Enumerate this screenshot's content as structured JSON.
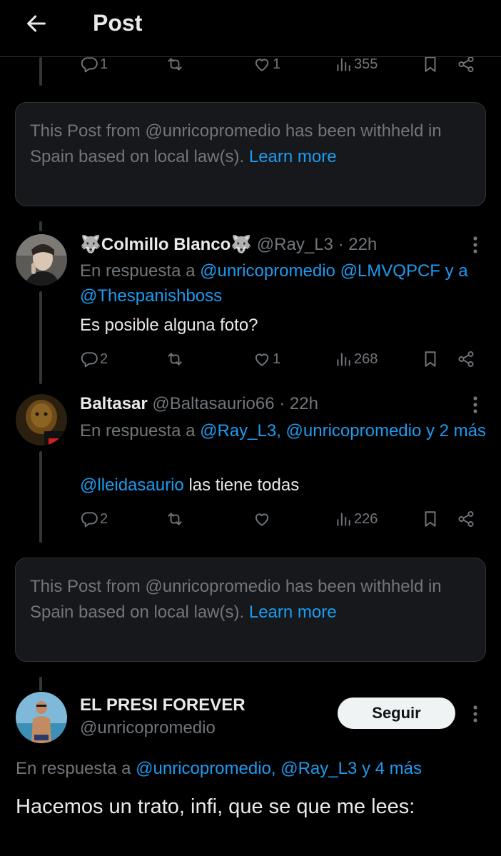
{
  "header": {
    "title": "Post"
  },
  "top_actions": {
    "replies": "1",
    "reposts": "",
    "likes": "1",
    "views": "355"
  },
  "notices": [
    {
      "text": "This Post from @unricopromedio has been withheld in Spain based on local law(s).",
      "link": "Learn more"
    },
    {
      "text": "This Post from @unricopromedio has been withheld in Spain based on local law(s).",
      "link": "Learn more"
    }
  ],
  "tweets": [
    {
      "name": "🐺Colmillo Blanco🐺",
      "handle": "@Ray_L3",
      "time": "· 22h",
      "reply_prefix": "En respuesta a",
      "reply_mentions": "@unricopromedio @LMVQPCF",
      "reply_joiner": "y a",
      "reply_mentions_2": "@Thespanishboss",
      "text": "Es posible alguna foto?",
      "replies": "2",
      "reposts": "",
      "likes": "1",
      "views": "268"
    },
    {
      "name": "Baltasar",
      "handle": "@Baltasaurio66",
      "time": "· 22h",
      "reply_prefix": "En respuesta a",
      "reply_mentions": "@Ray_L3, @unricopromedio y 2 más",
      "text_mention": "@lleidasaurio",
      "text": "las tiene todas",
      "replies": "2",
      "reposts": "",
      "likes": "",
      "views": "226"
    }
  ],
  "main_post": {
    "name": "EL PRESI FOREVER",
    "handle": "@unricopromedio",
    "follow_label": "Seguir",
    "reply_prefix": "En respuesta a",
    "reply_mentions": "@unricopromedio, @Ray_L3 y 4 más",
    "text": "Hacemos un trato, infi, que se que me lees:"
  },
  "colors": {
    "background": "#000000",
    "accent": "#1d9bf0",
    "muted": "#71767b",
    "text": "#e7e9ea"
  },
  "icons": [
    "back-arrow-icon",
    "reply-icon",
    "repost-icon",
    "like-icon",
    "views-icon",
    "bookmark-icon",
    "share-icon",
    "more-dots-icon"
  ]
}
